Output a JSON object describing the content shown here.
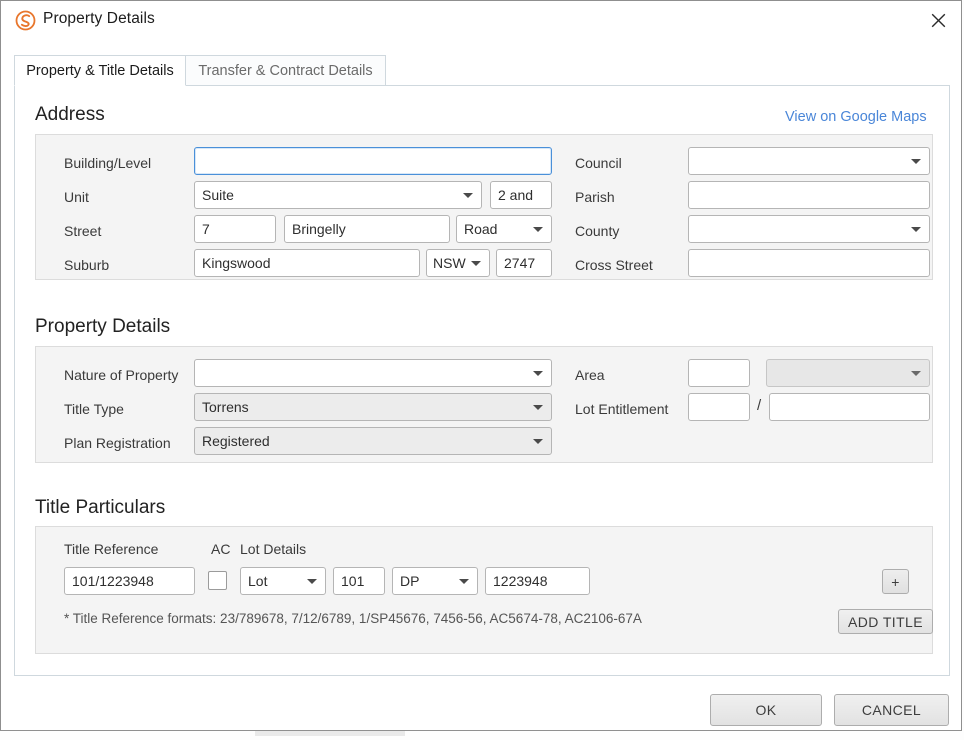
{
  "window": {
    "title": "Property Details",
    "logo_icon": "swirl-s-logo-icon",
    "close_icon": "close-icon",
    "accent_color": "#e8762c",
    "link_color": "#4a86d8",
    "focus_color": "#4a90d9"
  },
  "tabs": [
    {
      "label": "Property & Title Details",
      "active": true
    },
    {
      "label": "Transfer & Contract Details",
      "active": false
    }
  ],
  "address": {
    "heading": "Address",
    "maps_link": "View on Google Maps",
    "labels": {
      "building_level": "Building/Level",
      "unit": "Unit",
      "street": "Street",
      "suburb": "Suburb",
      "council": "Council",
      "parish": "Parish",
      "county": "County",
      "cross_street": "Cross Street"
    },
    "values": {
      "building_level": "",
      "unit_type": "Suite",
      "unit_number": "2 and",
      "street_number": "7",
      "street_name": "Bringelly",
      "street_type": "Road",
      "suburb": "Kingswood",
      "state": "NSW",
      "postcode": "2747",
      "council": "",
      "parish": "",
      "county": "",
      "cross_street": ""
    }
  },
  "property_details": {
    "heading": "Property Details",
    "labels": {
      "nature_of_property": "Nature of Property",
      "title_type": "Title Type",
      "plan_registration": "Plan Registration",
      "area": "Area",
      "lot_entitlement": "Lot Entitlement",
      "separator": "/"
    },
    "values": {
      "nature_of_property": "",
      "title_type": "Torrens",
      "plan_registration": "Registered",
      "area_value": "",
      "area_unit": "",
      "lot_entitlement_numerator": "",
      "lot_entitlement_denominator": ""
    }
  },
  "title_particulars": {
    "heading": "Title Particulars",
    "columns": {
      "title_reference": "Title Reference",
      "ac": "AC",
      "lot_details": "Lot Details"
    },
    "row": {
      "title_reference": "101/1223948",
      "ac_checked": false,
      "lot_label": "Lot",
      "lot_number": "101",
      "plan_type": "DP",
      "plan_number": "1223948"
    },
    "add_row_button": "+",
    "add_title_button": "ADD TITLE",
    "format_hint": "* Title Reference formats: 23/789678, 7/12/6789, 1/SP45676, 7456-56, AC5674-78, AC2106-67A"
  },
  "footer": {
    "ok_label": "OK",
    "cancel_label": "CANCEL"
  }
}
